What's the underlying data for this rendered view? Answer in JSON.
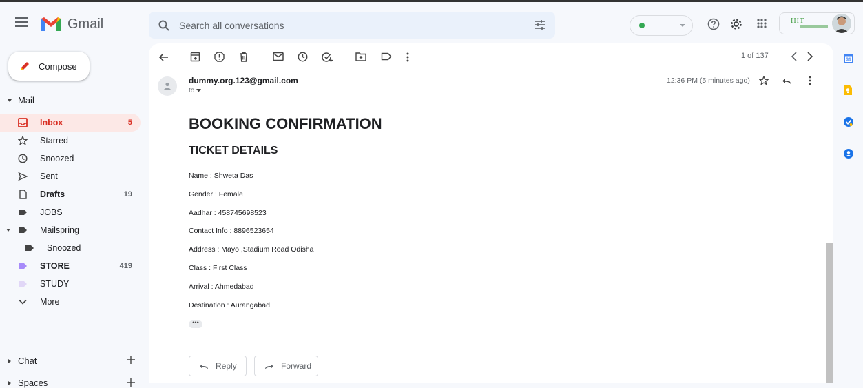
{
  "app": {
    "name": "Gmail"
  },
  "search": {
    "placeholder": "Search all conversations"
  },
  "header": {
    "account_org": "IIIT"
  },
  "sidebar": {
    "compose_label": "Compose",
    "mail_section": "Mail",
    "items": [
      {
        "label": "Inbox",
        "count": "5"
      },
      {
        "label": "Starred",
        "count": ""
      },
      {
        "label": "Snoozed",
        "count": ""
      },
      {
        "label": "Sent",
        "count": ""
      },
      {
        "label": "Drafts",
        "count": "19"
      },
      {
        "label": "JOBS",
        "count": ""
      },
      {
        "label": "Mailspring",
        "count": ""
      },
      {
        "label": "Snoozed",
        "count": ""
      },
      {
        "label": "STORE",
        "count": "419"
      },
      {
        "label": "STUDY",
        "count": ""
      },
      {
        "label": "More",
        "count": ""
      }
    ],
    "chat_section": "Chat",
    "spaces_section": "Spaces"
  },
  "toolbar": {
    "pager": "1 of 137"
  },
  "email": {
    "sender": "dummy.org.123@gmail.com",
    "to": "to",
    "time": "12:36 PM (5 minutes ago)",
    "heading": "BOOKING CONFIRMATION",
    "subheading": "TICKET DETAILS",
    "fields": [
      "Name : Shweta Das",
      "Gender : Female",
      "Aadhar : 458745698523",
      "Contact Info : 8896523654",
      "Address : Mayo ,Stadium Road Odisha",
      "Class : First Class",
      "Arrival : Ahmedabad",
      "Destination : Aurangabad"
    ],
    "ellipsis": "•••",
    "reply_label": "Reply",
    "forward_label": "Forward"
  },
  "colors": {
    "accent_red": "#d93025",
    "active_bg": "#fce8e6",
    "store_label": "#a78bfa",
    "study_label": "#e1d7f7"
  }
}
